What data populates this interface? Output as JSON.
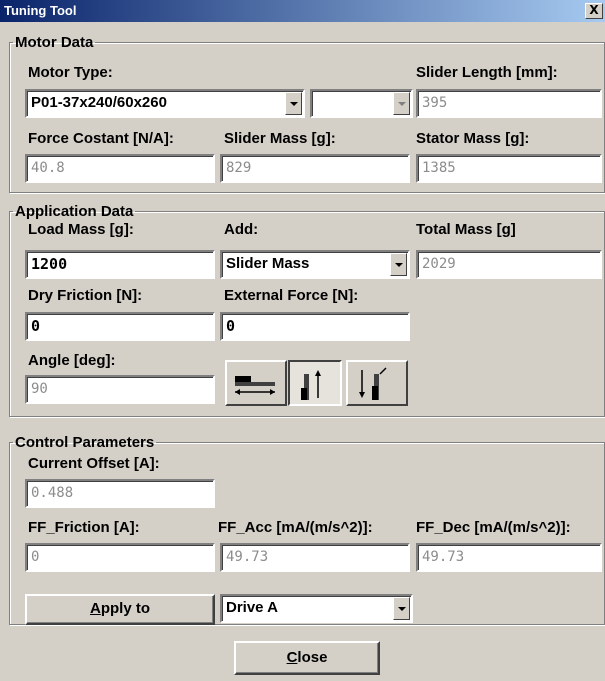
{
  "window": {
    "title": "Tuning Tool",
    "close_glyph": "X"
  },
  "motor_data": {
    "legend": "Motor Data",
    "motor_type_label": "Motor Type:",
    "motor_type_value": "P01-37x240/60x260",
    "secondary_combo_value": "",
    "slider_length_label": "Slider Length [mm]:",
    "slider_length_value": "395",
    "force_constant_label": "Force Costant [N/A]:",
    "force_constant_value": "40.8",
    "slider_mass_label": "Slider Mass [g]:",
    "slider_mass_value": "829",
    "stator_mass_label": "Stator Mass [g]:",
    "stator_mass_value": "1385"
  },
  "application_data": {
    "legend": "Application Data",
    "load_mass_label": "Load Mass [g]:",
    "load_mass_value": "1200",
    "add_label": "Add:",
    "add_value": "Slider Mass",
    "total_mass_label": "Total Mass [g]",
    "total_mass_value": "2029",
    "dry_friction_label": "Dry Friction [N]:",
    "dry_friction_value": "0",
    "external_force_label": "External Force [N]:",
    "external_force_value": "0",
    "angle_label": "Angle [deg]:",
    "angle_value": "90",
    "orientation_buttons": [
      "horizontal-orientation-icon",
      "vertical-up-orientation-icon",
      "vertical-down-orientation-icon"
    ],
    "selected_orientation": "vertical-up-orientation-icon"
  },
  "control_parameters": {
    "legend": "Control Parameters",
    "current_offset_label": "Current Offset [A]:",
    "current_offset_value": "0.488",
    "ff_friction_label": "FF_Friction [A]:",
    "ff_friction_value": "0",
    "ff_acc_label": "FF_Acc [mA/(m/s^2)]:",
    "ff_acc_value": "49.73",
    "ff_dec_label": "FF_Dec [mA/(m/s^2)]:",
    "ff_dec_value": "49.73"
  },
  "actions": {
    "apply_to_label": "Apply to",
    "drive_value": "Drive A",
    "close_label": "Close"
  },
  "colors": {
    "titlebar": "#0a246a",
    "face": "#d4d0c8",
    "readonly_text": "#8c8c8c"
  }
}
